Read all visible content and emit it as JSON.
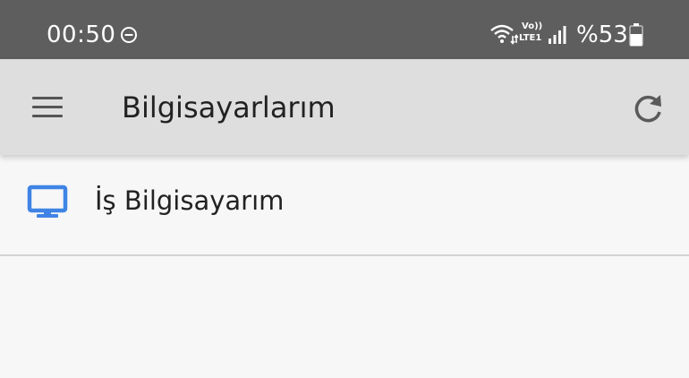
{
  "status_bar": {
    "time": "00:50",
    "network_volte": "Vo))",
    "network_lte": "LTE1",
    "battery": "%53",
    "icons": [
      "do-not-disturb-icon",
      "wifi-icon",
      "volte-lte-icon",
      "signal-icon",
      "battery-icon"
    ]
  },
  "app_bar": {
    "title": "Bilgisayarlarım",
    "menu_icon": "hamburger-menu-icon",
    "refresh_icon": "refresh-icon"
  },
  "computers": [
    {
      "name": "İş Bilgisayarım",
      "icon": "monitor-icon"
    }
  ],
  "colors": {
    "status_bar_bg": "#5e5e5e",
    "app_bar_bg": "#dedede",
    "page_bg": "#f7f7f7",
    "monitor_icon": "#3f84e5",
    "divider": "#d2d2d2"
  }
}
